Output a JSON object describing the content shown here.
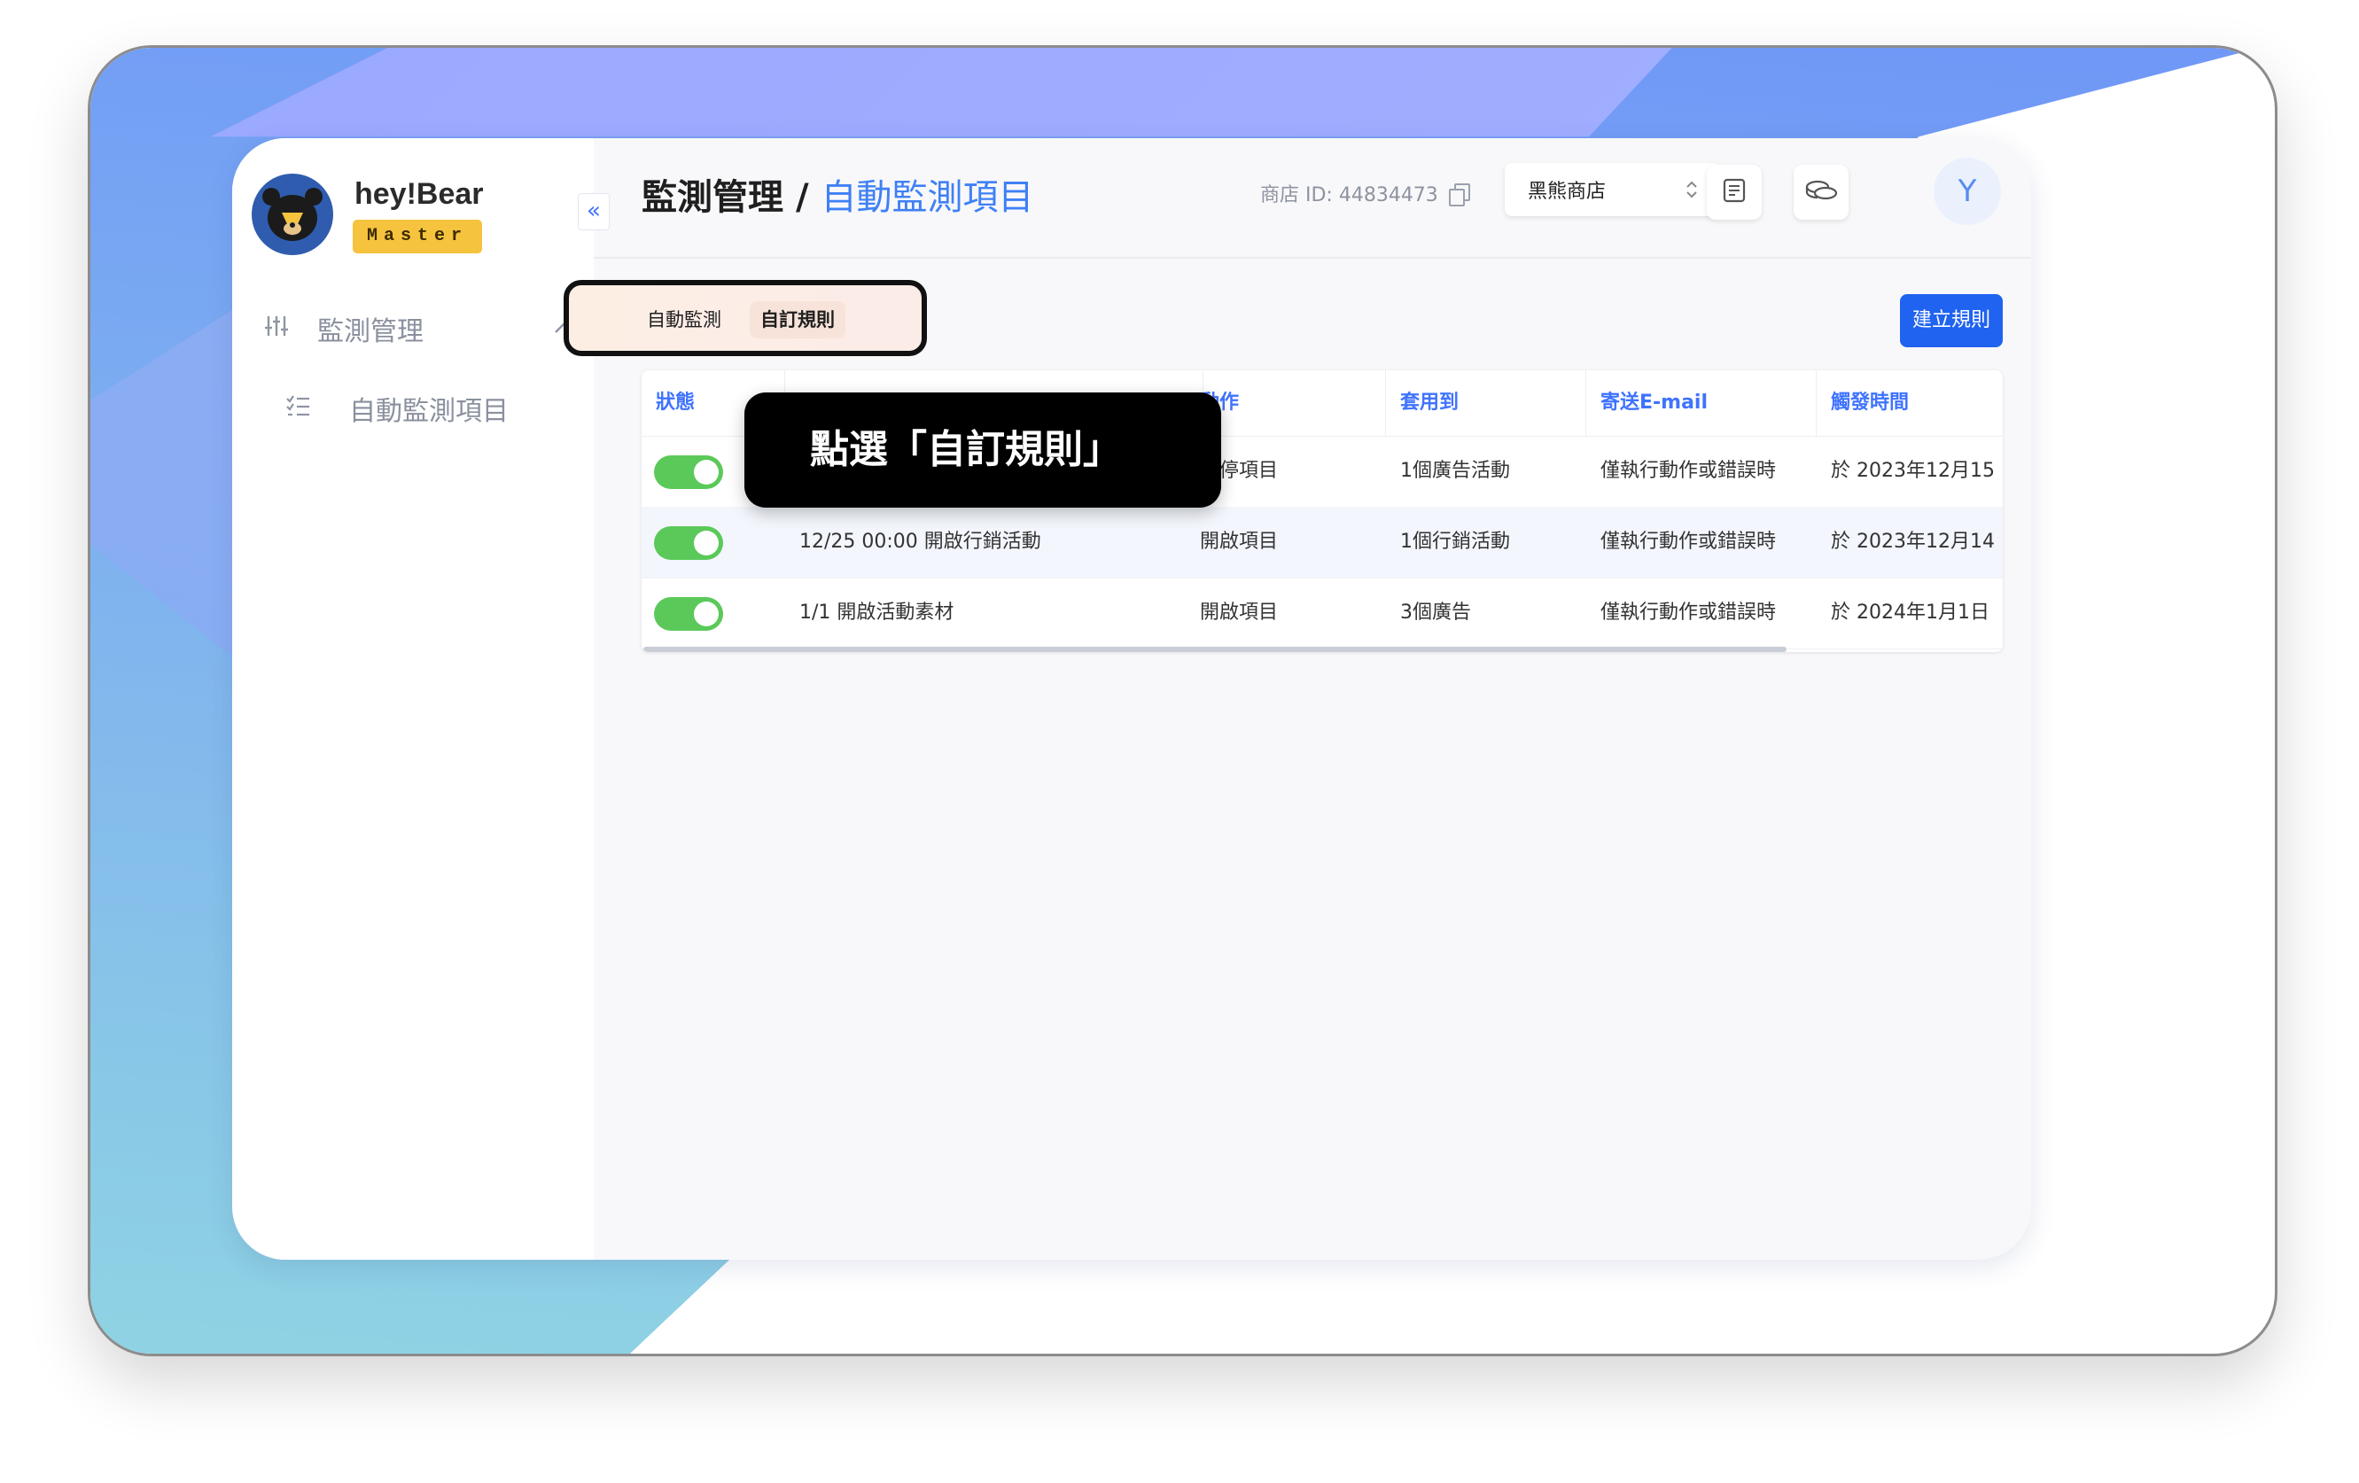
{
  "brand": {
    "name": "hey!Bear",
    "badge": "Master"
  },
  "sidebar": {
    "group": {
      "label": "監測管理",
      "icon": "sliders-icon"
    },
    "items": [
      {
        "label": "自動監測項目",
        "icon": "checklist-icon"
      }
    ]
  },
  "header": {
    "breadcrumb_parent": "監測管理",
    "breadcrumb_sep": "/",
    "breadcrumb_current": "自動監測項目",
    "store_id_label": "商店 ID: 44834473",
    "store_select": "黑熊商店",
    "avatar_initial": "Y"
  },
  "tabs": [
    {
      "label": "自動監測"
    },
    {
      "label": "自訂規則"
    }
  ],
  "create_button": "建立規則",
  "table": {
    "columns": [
      "狀態",
      "",
      "動作",
      "套用到",
      "寄送E-mail",
      "觸發時間"
    ],
    "rows": [
      {
        "enabled": true,
        "name": "",
        "action": "暫停項目",
        "apply_to": "1個廣告活動",
        "email": "僅執行動作或錯誤時",
        "trigger": "於 2023年12月15"
      },
      {
        "enabled": true,
        "name": "12/25 00:00 開啟行銷活動",
        "action": "開啟項目",
        "apply_to": "1個行銷活動",
        "email": "僅執行動作或錯誤時",
        "trigger": "於 2023年12月14"
      },
      {
        "enabled": true,
        "name": "1/1 開啟活動素材",
        "action": "開啟項目",
        "apply_to": "3個廣告",
        "email": "僅執行動作或錯誤時",
        "trigger": "於 2024年1月1日"
      }
    ]
  },
  "tooltip": "點選「自訂規則」",
  "colors": {
    "accent": "#1f63f0",
    "toggle_on": "#5bc95a",
    "badge": "#f6c33f"
  }
}
